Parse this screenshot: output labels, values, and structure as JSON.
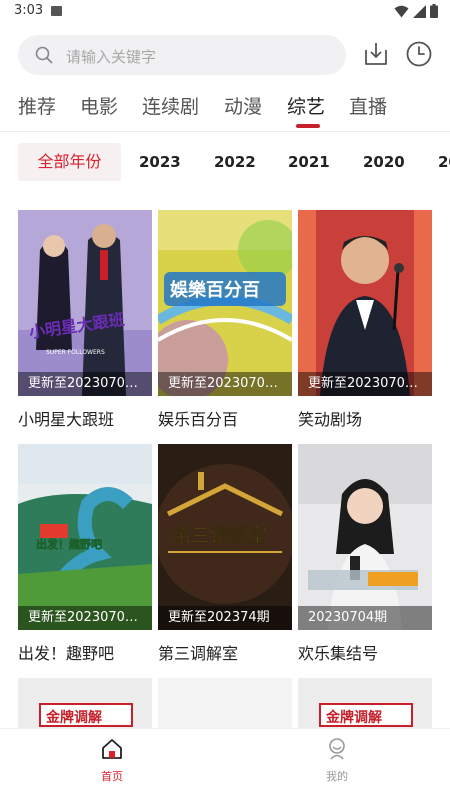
{
  "status_bar": {
    "time": "3:03"
  },
  "search": {
    "placeholder": "请输入关键字"
  },
  "tabs": [
    {
      "label": "推荐"
    },
    {
      "label": "电影"
    },
    {
      "label": "连续剧"
    },
    {
      "label": "动漫"
    },
    {
      "label": "综艺",
      "active": true
    },
    {
      "label": "直播"
    }
  ],
  "year_filter": {
    "selected": "全部年份",
    "years": [
      "2023",
      "2022",
      "2021",
      "2020",
      "20"
    ]
  },
  "items": [
    {
      "title": "小明星大跟班",
      "caption": "更新至2023070…"
    },
    {
      "title": "娱乐百分百",
      "caption": "更新至2023070…"
    },
    {
      "title": "笑动剧场",
      "caption": "更新至2023070…"
    },
    {
      "title": "出发！趣野吧",
      "caption": "更新至2023070…"
    },
    {
      "title": "第三调解室",
      "caption": "更新至202374期"
    },
    {
      "title": "欢乐集结号",
      "caption": "20230704期"
    },
    {
      "title": "",
      "caption": ""
    },
    {
      "title": "",
      "caption": ""
    },
    {
      "title": "",
      "caption": ""
    }
  ],
  "poster_text": [
    "小明星大跟班",
    "SUPER FOLLOWERS",
    "娛樂百分百",
    "出发！趣野吧",
    "第三调解室",
    "金牌调解",
    "金牌调解"
  ],
  "nav": {
    "home": "首页",
    "mine": "我的"
  },
  "colors": {
    "accent": "#d9202e",
    "underline": "#c8202b",
    "search_bg": "#f1f1f3",
    "chip_bg": "#f7f0f1"
  }
}
